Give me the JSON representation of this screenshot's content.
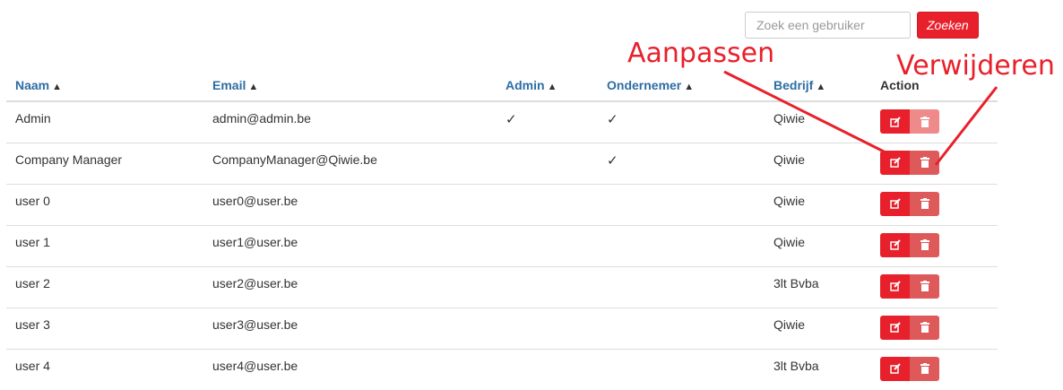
{
  "search": {
    "placeholder": "Zoek een gebruiker",
    "button_label": "Zoeken"
  },
  "columns": [
    "Naam",
    "Email",
    "Admin",
    "Ondernemer",
    "Bedrijf",
    "Action"
  ],
  "rows": [
    {
      "name": "Admin",
      "email": "admin@admin.be",
      "admin": "✓",
      "ondernemer": "✓",
      "bedrijf": "Qiwie"
    },
    {
      "name": "Company Manager",
      "email": "CompanyManager@Qiwie.be",
      "admin": "",
      "ondernemer": "✓",
      "bedrijf": "Qiwie"
    },
    {
      "name": "user 0",
      "email": "user0@user.be",
      "admin": "",
      "ondernemer": "",
      "bedrijf": "Qiwie"
    },
    {
      "name": "user 1",
      "email": "user1@user.be",
      "admin": "",
      "ondernemer": "",
      "bedrijf": "Qiwie"
    },
    {
      "name": "user 2",
      "email": "user2@user.be",
      "admin": "",
      "ondernemer": "",
      "bedrijf": "3lt Bvba"
    },
    {
      "name": "user 3",
      "email": "user3@user.be",
      "admin": "",
      "ondernemer": "",
      "bedrijf": "Qiwie"
    },
    {
      "name": "user 4",
      "email": "user4@user.be",
      "admin": "",
      "ondernemer": "",
      "bedrijf": "3lt Bvba"
    }
  ],
  "annotations": {
    "edit": "Aanpassen",
    "delete": "Verwijderen"
  },
  "icons": {
    "sort": "sort-icon",
    "edit": "edit-icon",
    "delete": "trash-icon"
  },
  "colors": {
    "accent": "#e8202b",
    "header_link": "#2d6da3",
    "delete_button": "#de5a5a"
  }
}
